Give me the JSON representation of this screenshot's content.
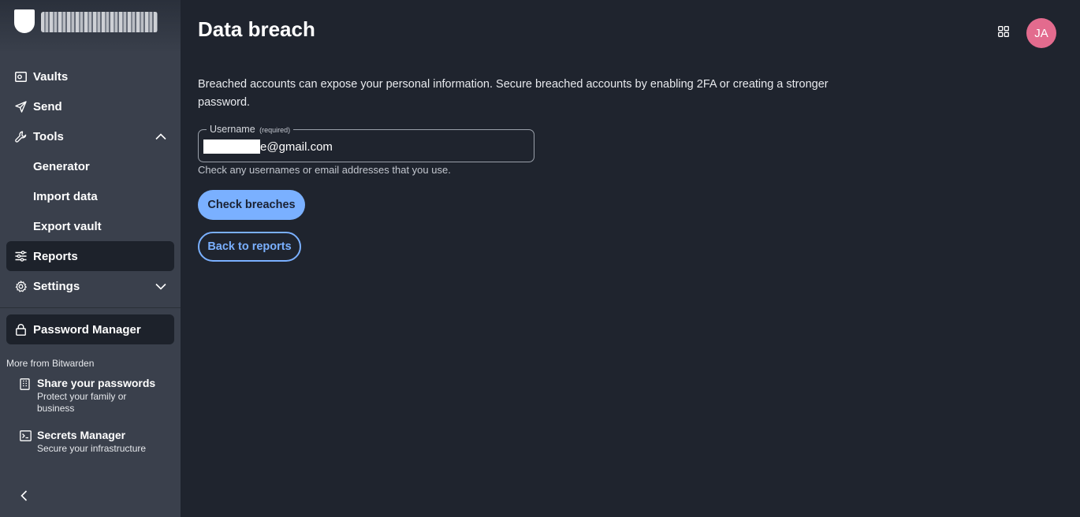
{
  "sidebar": {
    "nav": [
      {
        "label": "Vaults",
        "icon": "vault-icon"
      },
      {
        "label": "Send",
        "icon": "send-icon"
      },
      {
        "label": "Tools",
        "icon": "wrench-icon"
      },
      {
        "label": "Generator"
      },
      {
        "label": "Import data"
      },
      {
        "label": "Export vault"
      },
      {
        "label": "Reports",
        "icon": "sliders-icon"
      },
      {
        "label": "Settings",
        "icon": "gear-icon"
      }
    ],
    "password_manager": "Password Manager",
    "more_title": "More from Bitwarden",
    "products": [
      {
        "title": "Share your passwords",
        "desc": "Protect your family or business"
      },
      {
        "title": "Secrets Manager",
        "desc": "Secure your infrastructure"
      }
    ]
  },
  "header": {
    "title": "Data breach",
    "avatar_initials": "JA"
  },
  "main": {
    "description": "Breached accounts can expose your personal information. Secure breached accounts by enabling 2FA or creating a stronger password.",
    "username_label": "Username",
    "username_required": "(required)",
    "username_value": "e@gmail.com",
    "hint": "Check any usernames or email addresses that you use.",
    "check_button": "Check breaches",
    "back_button": "Back to reports"
  },
  "colors": {
    "sidebar_bg": "#3a404c",
    "main_bg": "#1f242e",
    "accent": "#7ab0ff",
    "avatar_bg": "#e36b8e"
  }
}
